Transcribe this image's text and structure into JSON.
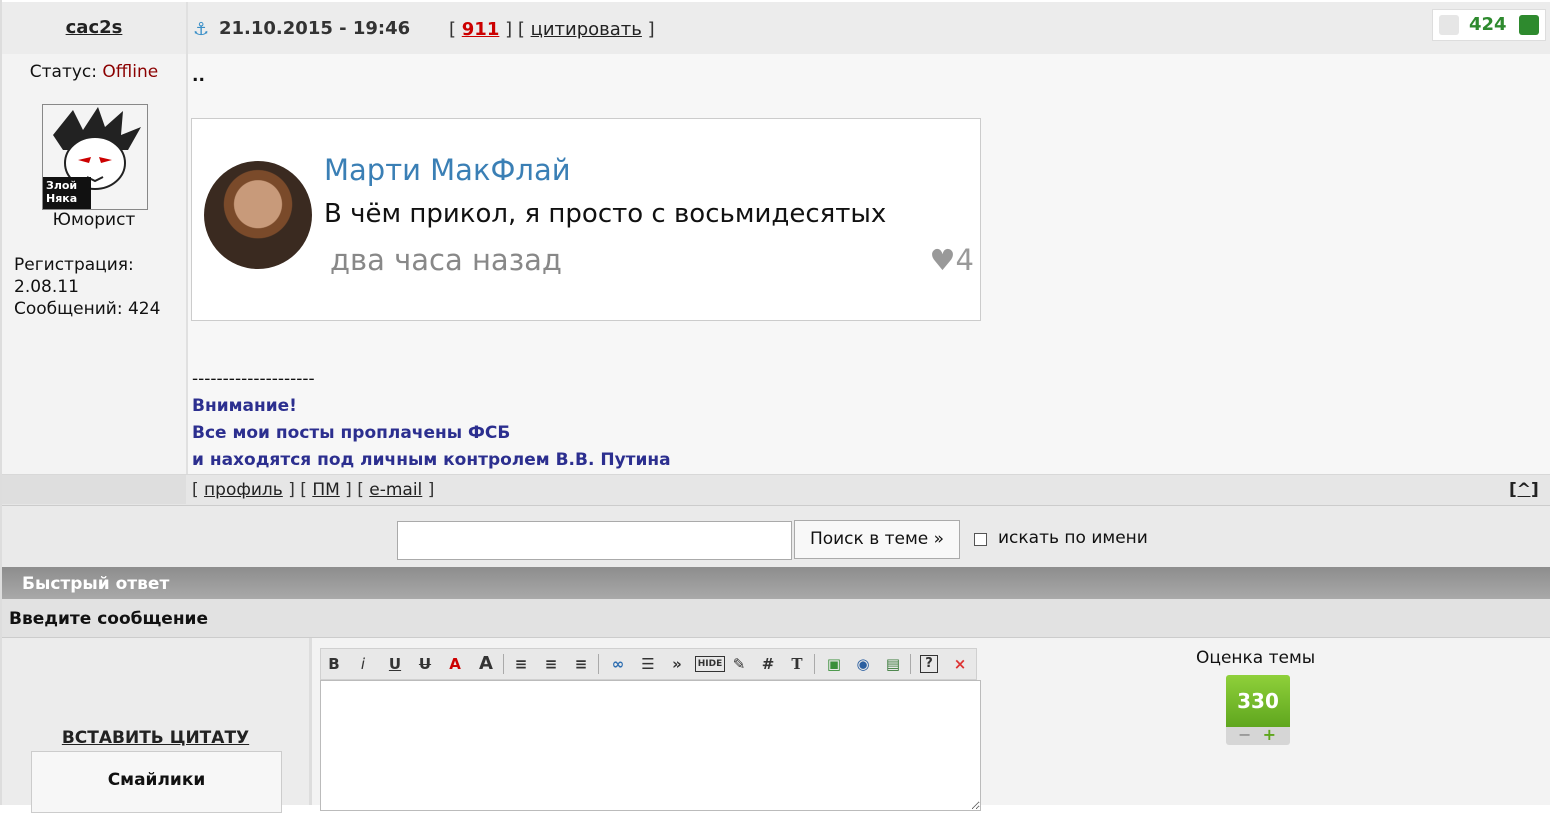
{
  "post": {
    "username": "cac2s",
    "datetime": "21.10.2015 - 19:46",
    "bracket_open": "[",
    "post_number": "911",
    "between": "] [",
    "quote_link": "цитировать",
    "bracket_close": "]",
    "rating": "424",
    "status_label": "Статус:",
    "status_value": "Offline",
    "avatar_text_top": "Злой",
    "avatar_text_bottom": "Няка",
    "rank": "Юморист",
    "reg_label": "Регистрация:",
    "reg_date": "2.08.11",
    "messages": "Сообщений: 424",
    "body_text": "..",
    "quote_image": {
      "name": "Марти МакФлай",
      "text": "В чём прикол, я просто с восьмидесятых",
      "time": "два часа назад",
      "likes": "4",
      "heart": "♥"
    },
    "signature": {
      "separator": "--------------------",
      "line1": "Внимание!",
      "line2": "Все мои посты проплачены ФСБ",
      "line3": "и находятся под личным контролем В.В. Путина"
    },
    "footer": {
      "open": "[",
      "profile": "профиль",
      "sep1": "] [",
      "pm": "ПМ",
      "sep2": "] [",
      "email": "e-mail",
      "close": "]",
      "up": "[^]"
    }
  },
  "search": {
    "input_value": "",
    "button": "Поиск в теме »",
    "checkbox_label": "искать по имени"
  },
  "quick_reply": {
    "title": "Быстрый ответ",
    "subtitle": "Введите сообщение",
    "insert_quote": "ВСТАВИТЬ ЦИТАТУ",
    "smileys": "Смайлики",
    "toolbar": [
      "B",
      "i",
      "U",
      "U",
      "A",
      "A",
      "≡",
      "≡",
      "≡",
      "∞",
      "☰",
      "»",
      "HIDE",
      "✎",
      "#",
      "T",
      "▣",
      "◉",
      "▤",
      "?",
      "×"
    ],
    "editor_value": ""
  },
  "topic_rating": {
    "label": "Оценка темы",
    "value": "330",
    "minus": "−",
    "plus": "+"
  },
  "colors": {
    "status_offline": "#8b0000",
    "post_number": "#cc0000",
    "rating_green": "#2e8a2e",
    "signature": "#2c2f8f",
    "rate_green": "#6bb523"
  }
}
